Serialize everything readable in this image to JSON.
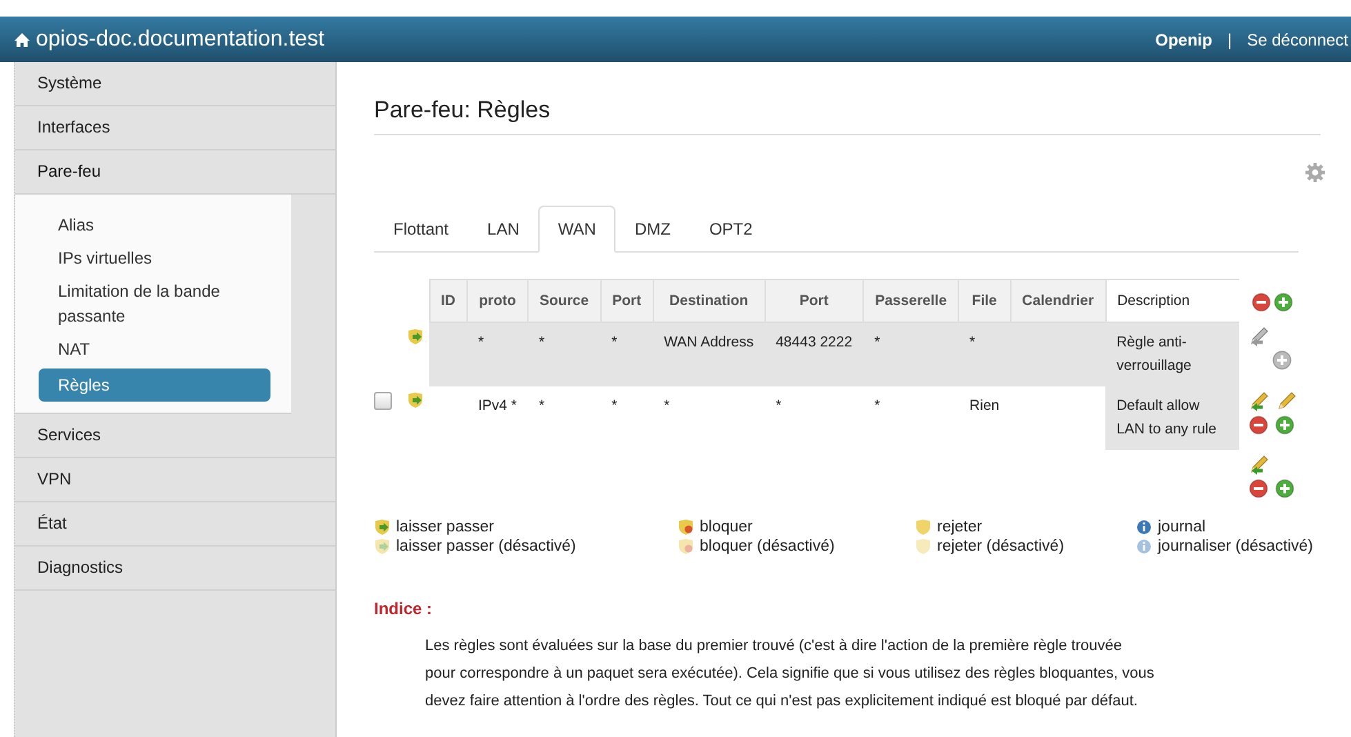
{
  "header": {
    "title": "opios-doc.documentation.test",
    "user": "Openip",
    "separator": "|",
    "logout": "Se déconnect"
  },
  "sidebar": {
    "items": [
      {
        "label": "Système",
        "expanded": false
      },
      {
        "label": "Interfaces",
        "expanded": false
      },
      {
        "label": "Pare-feu",
        "expanded": true,
        "children": [
          {
            "label": "Alias",
            "selected": false
          },
          {
            "label": "IPs virtuelles",
            "selected": false
          },
          {
            "label": "Limitation de la bande passante",
            "selected": false
          },
          {
            "label": "NAT",
            "selected": false
          },
          {
            "label": "Règles",
            "selected": true
          }
        ]
      },
      {
        "label": "Services",
        "expanded": false
      },
      {
        "label": "VPN",
        "expanded": false
      },
      {
        "label": "État",
        "expanded": false
      },
      {
        "label": "Diagnostics",
        "expanded": false
      }
    ]
  },
  "page_title": "Pare-feu: Règles",
  "tabs": [
    {
      "label": "Flottant",
      "selected": false
    },
    {
      "label": "LAN",
      "selected": false
    },
    {
      "label": "WAN",
      "selected": true
    },
    {
      "label": "DMZ",
      "selected": false
    },
    {
      "label": "OPT2",
      "selected": false
    }
  ],
  "table": {
    "columns": [
      "ID",
      "proto",
      "Source",
      "Port",
      "Destination",
      "Port",
      "Passerelle",
      "File",
      "Calendrier",
      "Description"
    ],
    "rows": [
      {
        "kind": "anti_lockout",
        "cells": [
          "",
          "*",
          "*",
          "*",
          "WAN Address",
          "48443 2222",
          "*",
          "*",
          "",
          "Règle anti-verrouillage"
        ]
      },
      {
        "kind": "rule",
        "checked": false,
        "cells": [
          "",
          "IPv4 *",
          "*",
          "*",
          "*",
          "*",
          "*",
          "Rien",
          "",
          "Default allow LAN to any rule"
        ]
      }
    ]
  },
  "legend": [
    {
      "label": "laisser passer",
      "kind": "pass",
      "disabled": false
    },
    {
      "label": "bloquer",
      "kind": "block",
      "disabled": false
    },
    {
      "label": "rejeter",
      "kind": "reject",
      "disabled": false
    },
    {
      "label": "journal",
      "kind": "log",
      "disabled": false
    },
    {
      "label": "laisser passer (désactivé)",
      "kind": "pass",
      "disabled": true
    },
    {
      "label": "bloquer (désactivé)",
      "kind": "block",
      "disabled": true
    },
    {
      "label": "rejeter (désactivé)",
      "kind": "reject",
      "disabled": true
    },
    {
      "label": "journaliser (désactivé)",
      "kind": "log",
      "disabled": true
    }
  ],
  "hint": {
    "title": "Indice :",
    "text": "Les règles sont évaluées sur la base du premier trouvé (c'est à dire l'action de la première règle trouvée pour correspondre à un paquet sera exécutée). Cela signifie que si vous utilisez des règles bloquantes, vous devez faire attention à l'ordre des règles. Tout ce qui n'est pas explicitement indiqué est bloqué par défaut."
  }
}
